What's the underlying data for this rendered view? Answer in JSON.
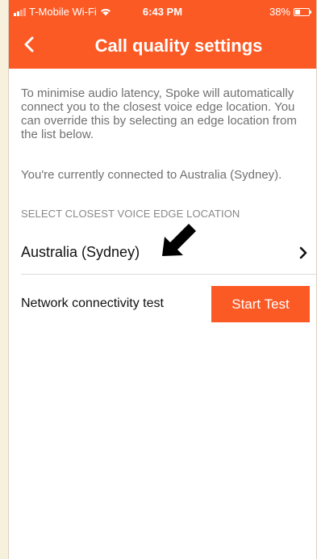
{
  "status_bar": {
    "carrier": "T-Mobile Wi-Fi",
    "time": "6:43 PM",
    "battery": "38%",
    "battery_level": 0.38,
    "icons": [
      "signal-icon",
      "wifi-icon",
      "battery-icon"
    ]
  },
  "header": {
    "title": "Call quality settings",
    "back_icon": "chevron-left-icon",
    "background_color": "#fb5a25"
  },
  "main": {
    "description": "To minimise audio latency, Spoke will automatically connect you to the closest voice edge location. You can override this by selecting an edge location from the list below.",
    "connected_text": "You're currently connected to Australia (Sydney).",
    "section_header": "SELECT CLOSEST VOICE EDGE LOCATION",
    "location": {
      "label": "Australia (Sydney)",
      "icon": "chevron-right-icon",
      "annotation_icon": "black-arrow-icon"
    },
    "network_test": {
      "label": "Network connectivity test",
      "button_label": "Start Test",
      "button_color": "#fb5a25"
    }
  }
}
